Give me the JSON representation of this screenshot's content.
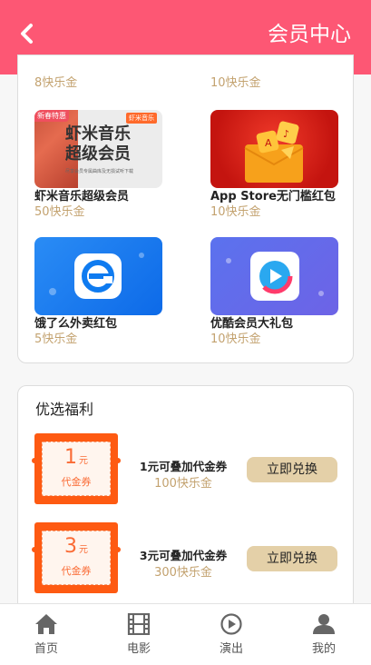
{
  "header": {
    "title": "会员中心"
  },
  "gifts_partial": [
    {
      "price": "8快乐金"
    },
    {
      "price": "10快乐金"
    }
  ],
  "gifts": [
    {
      "name": "虾米音乐超级会员",
      "price": "50快乐金",
      "image_tag": "新春特惠",
      "image_brand": "虾米音乐",
      "image_line1": "虾米音乐",
      "image_line2": "超级会员",
      "image_sub": "尽享会员专属曲库及无损试听下载"
    },
    {
      "name": "App Store无门槛红包",
      "price": "10快乐金"
    },
    {
      "name": "饿了么外卖红包",
      "price": "5快乐金"
    },
    {
      "name": "优酷会员大礼包",
      "price": "10快乐金"
    }
  ],
  "benefits": {
    "title": "优选福利",
    "offers": [
      {
        "amount": "1",
        "unit": "元",
        "coupon_label": "代金券",
        "title": "1元可叠加代金券",
        "price": "100快乐金",
        "button": "立即兑换"
      },
      {
        "amount": "3",
        "unit": "元",
        "coupon_label": "代金券",
        "title": "3元可叠加代金券",
        "price": "300快乐金",
        "button": "立即兑换"
      }
    ]
  },
  "tabbar": [
    {
      "label": "首页",
      "icon": "home-icon"
    },
    {
      "label": "电影",
      "icon": "film-icon"
    },
    {
      "label": "演出",
      "icon": "play-icon"
    },
    {
      "label": "我的",
      "icon": "user-icon"
    }
  ],
  "colors": {
    "header": "#fd5774",
    "price": "#c3a26f",
    "coupon": "#fe5a12",
    "button": "#e4d0a8"
  }
}
